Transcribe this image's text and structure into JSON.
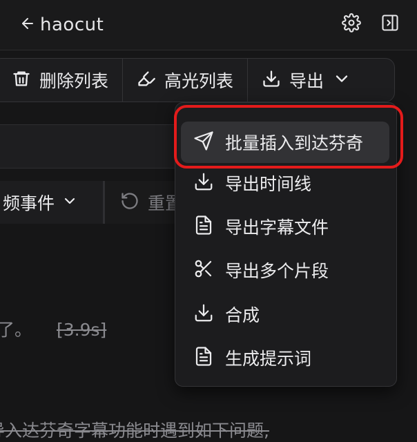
{
  "app": {
    "title": "haocut"
  },
  "toolbar": {
    "delete_list": "删除列表",
    "highlight_list": "高光列表",
    "export": "导出"
  },
  "filters": {
    "event_label": "频事件",
    "reset_label": "重置"
  },
  "content": {
    "line1_prefix": "了。",
    "line1_duration": "[3.9s]",
    "line2": "导入达芬奇字幕功能时遇到如下问题,"
  },
  "export_menu": {
    "items": [
      {
        "label": "批量插入到达芬奇",
        "icon": "send-icon",
        "active": true
      },
      {
        "label": "导出时间线",
        "icon": "download-icon"
      },
      {
        "label": "导出字幕文件",
        "icon": "document-icon"
      },
      {
        "label": "导出多个片段",
        "icon": "scissors-icon"
      },
      {
        "label": "合成",
        "icon": "download-icon"
      },
      {
        "label": "生成提示词",
        "icon": "document-icon"
      }
    ]
  },
  "colors": {
    "highlight_border": "#e31b1b",
    "background": "#161617"
  }
}
